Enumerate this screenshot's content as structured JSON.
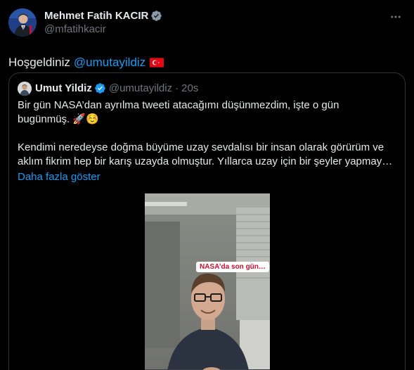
{
  "author": {
    "display_name": "Mehmet Fatih KACIR",
    "handle": "@mfatihkacir",
    "avatar_icon": "profile-photo-icon",
    "verified_color": "#1d9bf0"
  },
  "tweet": {
    "text": "Hoşgeldiniz",
    "mention": "@umutayildiz",
    "flag_icon": "turkey-flag-icon"
  },
  "quoted": {
    "display_name": "Umut Yildiz",
    "handle": "@umutayildiz",
    "separator": "·",
    "time": "20s",
    "line1": "Bir gün NASA’dan ayrılma tweeti atacağımı düşünmezdim, işte o gün",
    "line2": "bugünmüş. 🚀☺️",
    "line3": "Kendimi neredeyse doğma büyüme uzay sevdalısı bir insan olarak görürüm ve",
    "line4": "aklım fikrim hep bir karış uzayda olmuştur. Yıllarca uzay için bir şeyler yapmay…",
    "show_more": "Daha fazla göster",
    "video_caption": "NASA’da son gün…"
  },
  "colors": {
    "background": "#000000",
    "text": "#e7e9ea",
    "muted": "#71767b",
    "link": "#1d9bf0",
    "border": "#2f3336"
  }
}
